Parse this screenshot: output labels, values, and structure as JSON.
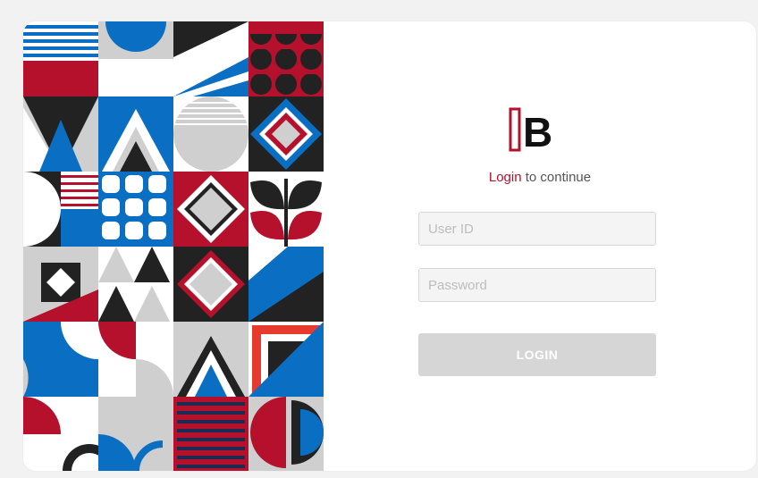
{
  "brand": {
    "logo_letter": "B",
    "accent_color": "#b5102c"
  },
  "login": {
    "subtitle_accent": "Login",
    "subtitle_rest": " to continue",
    "user_id_placeholder": "User ID",
    "password_placeholder": "Password",
    "button_label": "LOGIN"
  },
  "colors": {
    "red": "#b5102c",
    "blue": "#0a6fc2",
    "navy": "#1c2b4f",
    "gray": "#cfcfcf",
    "black": "#222222",
    "button_disabled": "#d6d6d6"
  }
}
